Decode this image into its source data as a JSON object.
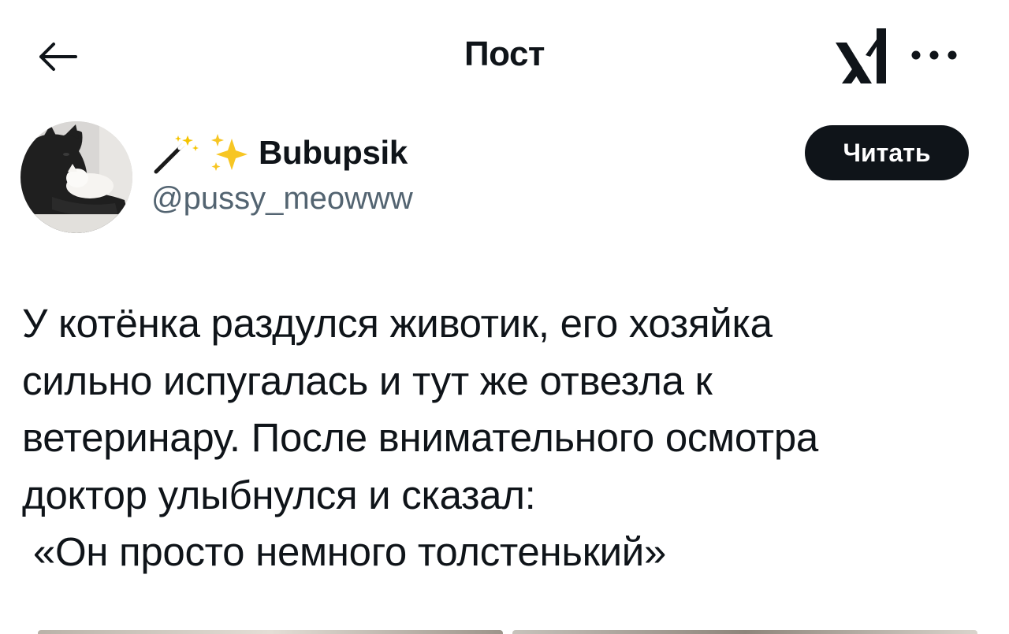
{
  "header": {
    "title": "Пост",
    "back_icon": "arrow-left-icon",
    "logo_icon": "x-logo-icon",
    "more_icon": "more-horizontal-icon"
  },
  "author": {
    "display_name": "Bubupsik",
    "handle": "@pussy_meowww",
    "name_emojis": [
      "magic-wand-icon",
      "sparkles-icon"
    ],
    "avatar": "black-and-white-cats-avatar"
  },
  "follow_button": {
    "label": "Читать"
  },
  "post": {
    "text": "У котёнка раздулся животик, его хозяйка\nсильно испугалась и тут же отвезла к\nветеринару. После внимательного осмотра\nдоктор улыбнулся и сказал:\n «Он просто немного толстенький»"
  },
  "colors": {
    "text_primary": "#0f1419",
    "text_secondary": "#536471",
    "button_bg": "#0f1419",
    "button_text": "#ffffff",
    "background": "#ffffff"
  }
}
